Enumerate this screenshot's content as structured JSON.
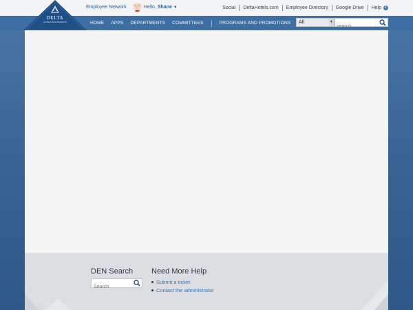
{
  "brand": {
    "name": "DELTA",
    "tagline": "HOTELS AND RESORTS"
  },
  "topbar": {
    "employee_network": "Employee Network",
    "greeting_prefix": "Hello,",
    "user_name": "Shane",
    "links": [
      "Social",
      "DeltaHotels.com",
      "Employee Directory",
      "Google Drive",
      "Help"
    ]
  },
  "nav": {
    "items": [
      "HOME",
      "APPS",
      "DEPARTMENTS",
      "COMMITTEES",
      "PROGRAMS AND PROMOTIONS"
    ]
  },
  "search": {
    "scope_selected": "All",
    "placeholder": "search"
  },
  "footer": {
    "den_title": "DEN Search",
    "den_placeholder": "Search",
    "help_title": "Need More Help",
    "help_links": [
      "Submit a ticket",
      "Contact the administrator"
    ]
  },
  "colors": {
    "nav_bg": "#3d6fa5",
    "logo_bg": "#1f4f86",
    "link": "#2a7ab8",
    "content_bg": "#f4f4f4",
    "footer_bg": "#dcdee1"
  }
}
